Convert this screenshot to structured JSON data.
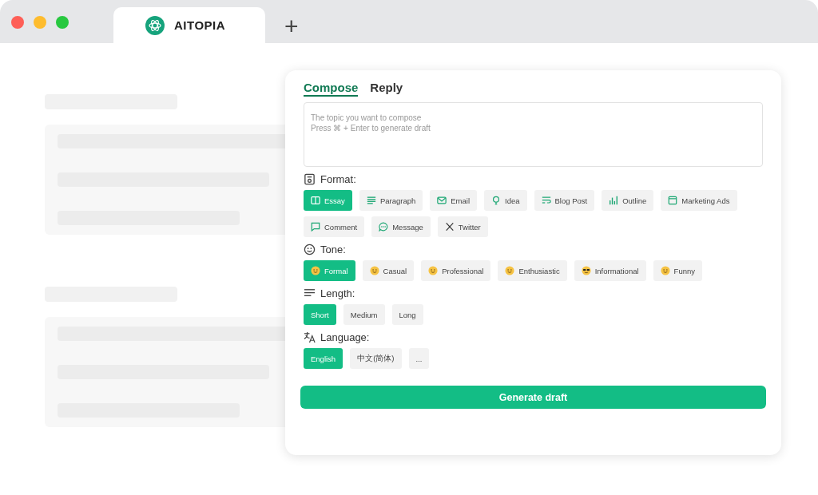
{
  "browser": {
    "tab_title": "AITOPIA",
    "new_tab": "+"
  },
  "tabs": [
    {
      "label": "Compose",
      "selected": true
    },
    {
      "label": "Reply",
      "selected": false
    }
  ],
  "topic": {
    "placeholder": "The topic you want to compose\nPress ⌘ + Enter to generate draft"
  },
  "sections": [
    {
      "kind": "format",
      "label": "Format:",
      "options": [
        {
          "label": "Essay",
          "kind": "book",
          "selected": true
        },
        {
          "label": "Paragraph",
          "kind": "lines",
          "selected": false
        },
        {
          "label": "Email",
          "kind": "mail",
          "selected": false
        },
        {
          "label": "Idea",
          "kind": "bulb",
          "selected": false
        },
        {
          "label": "Blog Post",
          "kind": "wrap",
          "selected": false
        },
        {
          "label": "Outline",
          "kind": "bars",
          "selected": false
        },
        {
          "label": "Marketing Ads",
          "kind": "window",
          "selected": false
        },
        {
          "label": "Comment",
          "kind": "bubble",
          "selected": false
        },
        {
          "label": "Message",
          "kind": "dots",
          "selected": false
        },
        {
          "label": "Twitter",
          "kind": "x",
          "selected": false
        }
      ]
    },
    {
      "kind": "tone",
      "label": "Tone:",
      "options": [
        {
          "label": "Formal",
          "kind": "face",
          "selected": true
        },
        {
          "label": "Casual",
          "kind": "face",
          "selected": false
        },
        {
          "label": "Professional",
          "kind": "face",
          "selected": false
        },
        {
          "label": "Enthusiastic",
          "kind": "face",
          "selected": false
        },
        {
          "label": "Informational",
          "kind": "shades",
          "selected": false
        },
        {
          "label": "Funny",
          "kind": "face",
          "selected": false
        }
      ]
    },
    {
      "kind": "length",
      "label": "Length:",
      "options": [
        {
          "label": "Short",
          "kind": "text",
          "selected": true
        },
        {
          "label": "Medium",
          "kind": "text",
          "selected": false
        },
        {
          "label": "Long",
          "kind": "text",
          "selected": false
        }
      ]
    },
    {
      "kind": "language",
      "label": "Language:",
      "options": [
        {
          "label": "English",
          "kind": "text",
          "selected": true
        },
        {
          "label": "中文(简体)",
          "kind": "text",
          "selected": false
        },
        {
          "label": "...",
          "kind": "text",
          "selected": false
        }
      ]
    }
  ],
  "generate_button": "Generate draft"
}
